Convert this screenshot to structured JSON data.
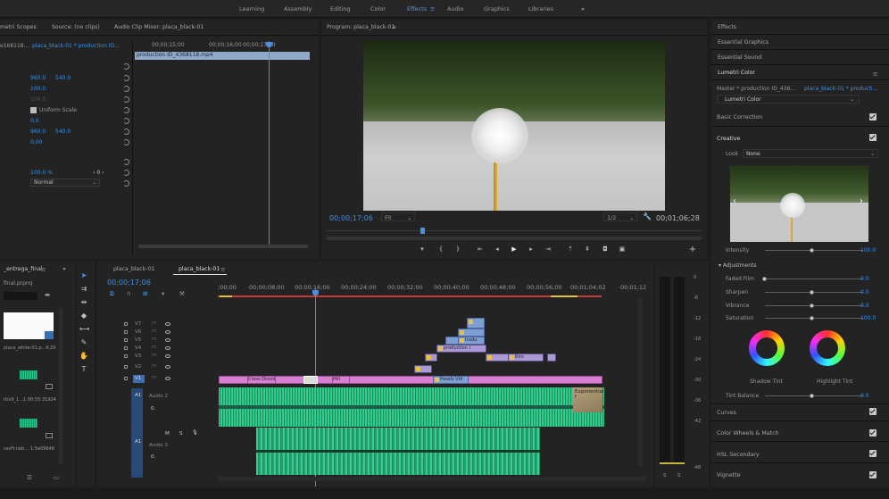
{
  "workspaces": [
    "Learning",
    "Assembly",
    "Editing",
    "Color",
    "Effects",
    "Audio",
    "Graphics",
    "Libraries"
  ],
  "workspace_active": "Effects",
  "workspace_menu": "≡",
  "overflow": "»",
  "source": {
    "tabs": [
      "metri Scopes",
      "Source: (no clips)",
      "Audio Clip Mixer: placa_black-01"
    ],
    "seq_label": "placa_black-01 * production ID...",
    "seq_left": "e168118...",
    "clip_name": "production ID_4368118.mp4",
    "ruler": [
      "00;00;15;00",
      "00;00;16;00",
      "00;00;17;00"
    ],
    "rows": [
      {
        "a": "960.0",
        "b": "540.0"
      },
      {
        "a": "100.0",
        "b": ""
      },
      {
        "a": "100.0",
        "b": ""
      },
      {
        "a": "Uniform Scale",
        "b": ""
      },
      {
        "a": "0.0",
        "b": ""
      },
      {
        "a": "960.0",
        "b": "540.0"
      },
      {
        "a": "0.00",
        "b": ""
      },
      {
        "a": "100.0 %",
        "b": ""
      },
      {
        "a": "Normal",
        "b": ""
      }
    ],
    "keyframe_value": "0"
  },
  "program": {
    "title": "Program: placa_black-01",
    "timecode": "00;00;17;06",
    "fit": "Fit",
    "resolution": "1/2",
    "duration": "00;01;06;28"
  },
  "project": {
    "tab": "_entrega_final",
    "file": "final.prproj",
    "items": [
      {
        "name": "placa_white-01.p...",
        "dur": "4;29"
      },
      {
        "name": "rtix9_1...",
        "dur": "1:00:55:31924"
      },
      {
        "name": "ravFr.neb...",
        "dur": "1:5e09648"
      }
    ]
  },
  "timeline": {
    "tabs": [
      "placa_black-01",
      "placa_black-01"
    ],
    "timecode": "00;00;17;06",
    "ruler": [
      ";00;00",
      "00;00;08;00",
      "00;00;16;00",
      "00;00;24;00",
      "00;00;32;00",
      "00;00;40;00",
      "00;00;48;00",
      "00;00;56;00",
      "00;01;04;02",
      "00;01;12"
    ],
    "video_tracks": [
      "V7",
      "V6",
      "V5",
      "V4",
      "V3",
      "V2",
      "V1"
    ],
    "audio_tracks": [
      {
        "id": "A1",
        "name": "Audio 2",
        "vol": "0."
      },
      {
        "id": "A1",
        "name": "Audio 3",
        "vol": "0."
      }
    ],
    "clips": [
      {
        "label": "Cross Dissol",
        "track": "V1"
      },
      {
        "label": "Hill",
        "track": "V1"
      },
      {
        "label": "Pexels Vid",
        "track": "V1"
      },
      {
        "label": "Insdu",
        "track": "V5"
      },
      {
        "label": "production I",
        "track": "V4"
      },
      {
        "label": "Rim",
        "track": "V3"
      },
      {
        "label": "Exponential f",
        "track": "A1"
      }
    ],
    "meter_db": [
      "0",
      "-6",
      "-12",
      "-18",
      "-24",
      "-30",
      "-36",
      "-42",
      "-48"
    ],
    "meter_foot": [
      "S",
      "S"
    ]
  },
  "effects_panel": {
    "headers": [
      "Effects",
      "Essential Graphics",
      "Essential Sound",
      "Lumetri Color"
    ],
    "master": "Master * production ID_436...",
    "clip": "placa_black-01 * producti...",
    "effect": "Lumetri Color",
    "sections": [
      "Basic Correction",
      "Creative",
      "Curves",
      "Color Wheels & Match",
      "HSL Secondary",
      "Vignette"
    ],
    "look_label": "Look",
    "look_value": "None",
    "intensity_label": "Intensity",
    "intensity_val": "100.0",
    "adjustments": "Adjustments",
    "adj": [
      {
        "label": "Faded Film",
        "val": "0.0",
        "pos": 0.0
      },
      {
        "label": "Sharpen",
        "val": "0.0",
        "pos": 0.5
      },
      {
        "label": "Vibrance",
        "val": "0.0",
        "pos": 0.5
      },
      {
        "label": "Saturation",
        "val": "100.0",
        "pos": 0.5
      }
    ],
    "shadow_tint": "Shadow Tint",
    "highlight_tint": "Highlight Tint",
    "tint_balance": "Tint Balance",
    "tint_val": "0.0"
  }
}
